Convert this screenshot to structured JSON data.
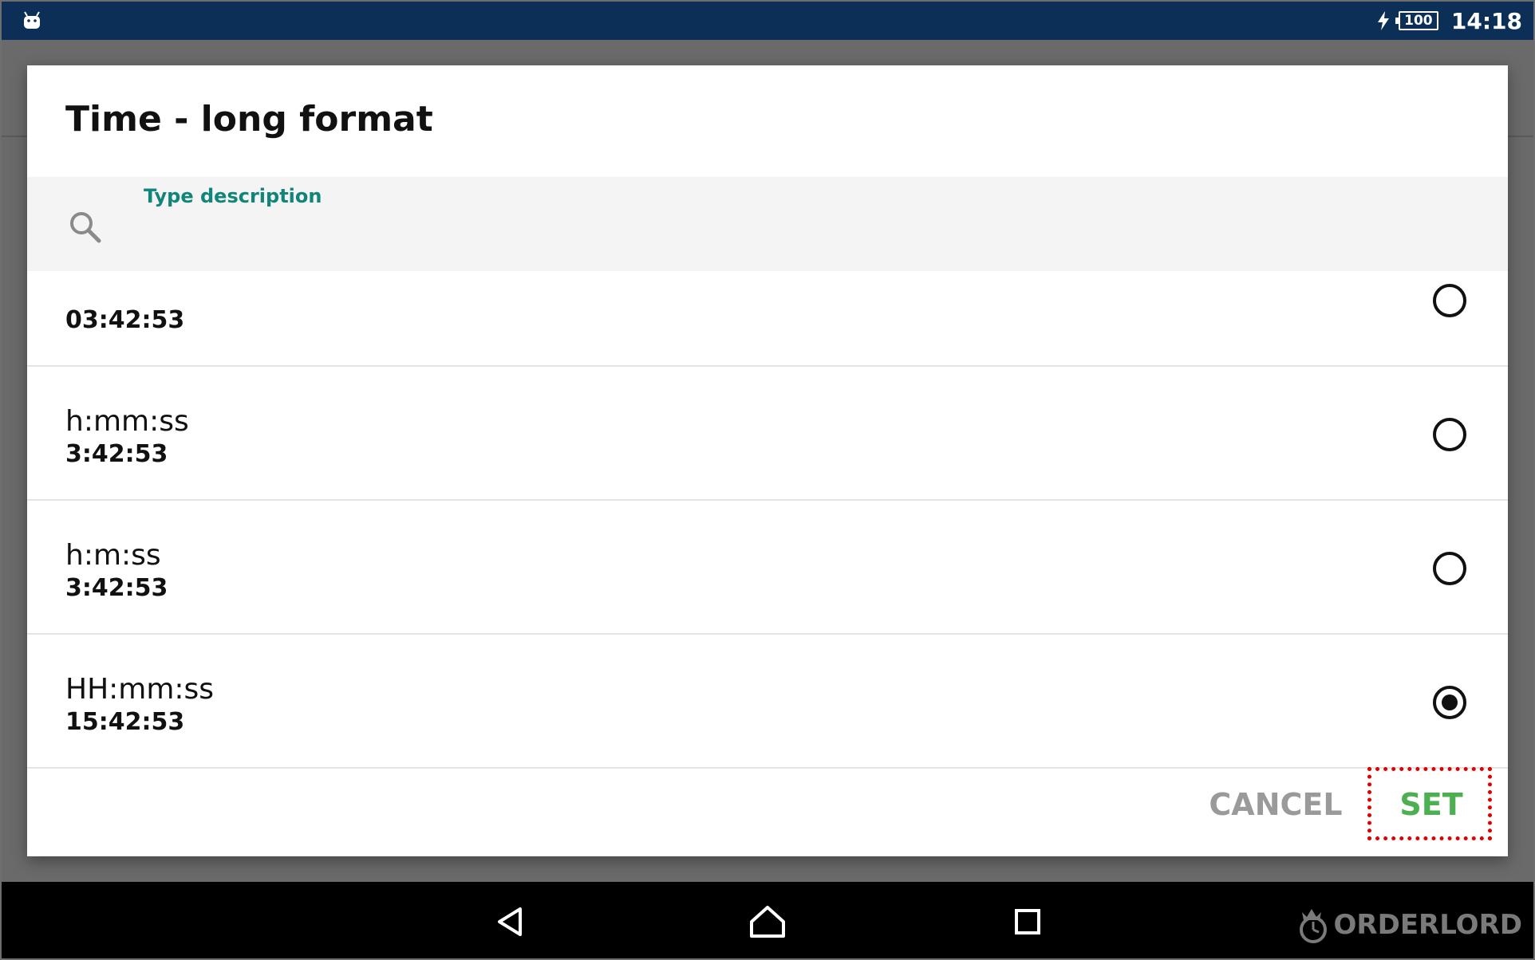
{
  "status_bar": {
    "battery_level": "100",
    "time": "14:18",
    "left_icon": "android-icon",
    "charging_icon": "bolt-icon"
  },
  "dialog": {
    "title": "Time - long format",
    "search": {
      "label": "Type description",
      "value": "",
      "icon": "search-icon"
    },
    "items": [
      {
        "title": "",
        "subtitle": "03:42:53",
        "selected": false
      },
      {
        "title": "h:mm:ss",
        "subtitle": "3:42:53",
        "selected": false
      },
      {
        "title": "h:m:ss",
        "subtitle": "3:42:53",
        "selected": false
      },
      {
        "title": "HH:mm:ss",
        "subtitle": "15:42:53",
        "selected": true
      }
    ],
    "buttons": {
      "cancel": "CANCEL",
      "set": "SET"
    }
  },
  "navigation": {
    "back_icon": "back-icon",
    "home_icon": "home-icon",
    "recents_icon": "recents-icon"
  },
  "watermark": {
    "text": "ORDERLORD"
  },
  "colors": {
    "status_bar": "#0b2f57",
    "accent_teal": "#12857a",
    "set_green": "#4caf50",
    "cancel_gray": "#9a9a9a",
    "highlight_red": "#e00000"
  }
}
